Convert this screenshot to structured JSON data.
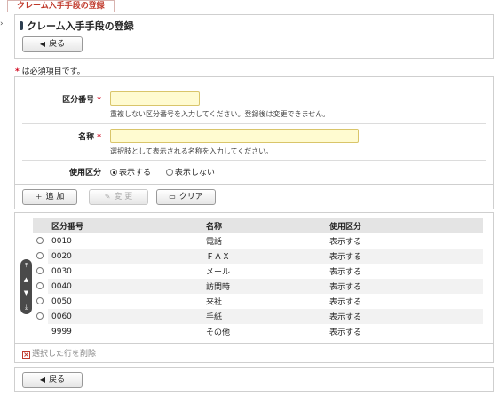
{
  "tab": {
    "label": "クレーム入手手段の登録"
  },
  "header": {
    "title": "クレーム入手手段の登録",
    "back_label": "戻る"
  },
  "required_note": {
    "star": "*",
    "text": " は必須項目です。"
  },
  "form": {
    "code": {
      "label": "区分番号",
      "star": "*",
      "value": "",
      "hint": "重複しない区分番号を入力してください。登録後は変更できません。"
    },
    "name": {
      "label": "名称",
      "star": "*",
      "value": "",
      "hint": "選択肢として表示される名称を入力してください。"
    },
    "usage": {
      "label": "使用区分",
      "options": [
        "表示する",
        "表示しない"
      ],
      "selected": "表示する"
    },
    "buttons": {
      "add": "追 加",
      "change": "変 更",
      "clear": "クリア"
    }
  },
  "table": {
    "columns": [
      "区分番号",
      "名称",
      "使用区分"
    ],
    "rows": [
      {
        "code": "0010",
        "name": "電話",
        "usage": "表示する",
        "selectable": true
      },
      {
        "code": "0020",
        "name": "ＦＡＸ",
        "usage": "表示する",
        "selectable": true
      },
      {
        "code": "0030",
        "name": "メール",
        "usage": "表示する",
        "selectable": true
      },
      {
        "code": "0040",
        "name": "訪問時",
        "usage": "表示する",
        "selectable": true
      },
      {
        "code": "0050",
        "name": "来社",
        "usage": "表示する",
        "selectable": true
      },
      {
        "code": "0060",
        "name": "手紙",
        "usage": "表示する",
        "selectable": true
      },
      {
        "code": "9999",
        "name": "その他",
        "usage": "表示する",
        "selectable": false
      }
    ],
    "delete_label": "選択した行を削除"
  },
  "footer": {
    "back_label": "戻る"
  }
}
